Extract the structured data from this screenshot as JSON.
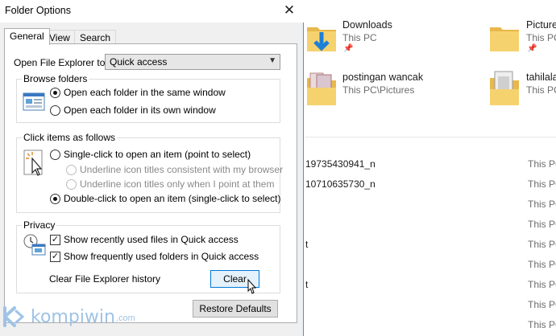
{
  "dialog": {
    "title": "Folder Options",
    "tabs": [
      {
        "label": "General",
        "active": true
      },
      {
        "label": "View",
        "active": false
      },
      {
        "label": "Search",
        "active": false
      }
    ],
    "open_explorer_label": "Open File Explorer to:",
    "open_explorer_value": "Quick access",
    "browse_folders": {
      "legend": "Browse folders",
      "options": [
        {
          "label": "Open each folder in the same window",
          "selected": true
        },
        {
          "label": "Open each folder in its own window",
          "selected": false
        }
      ]
    },
    "click_items": {
      "legend": "Click items as follows",
      "single_click": {
        "label": "Single-click to open an item (point to select)",
        "selected": false
      },
      "underline_consistent": {
        "label": "Underline icon titles consistent with my browser",
        "enabled": false
      },
      "underline_point": {
        "label": "Underline icon titles only when I point at them",
        "enabled": false
      },
      "double_click": {
        "label": "Double-click to open an item (single-click to select)",
        "selected": true
      }
    },
    "privacy": {
      "legend": "Privacy",
      "show_recent_files": {
        "label": "Show recently used files in Quick access",
        "checked": true
      },
      "show_frequent_folders": {
        "label": "Show frequently used folders in Quick access",
        "checked": true
      },
      "clear_history_label": "Clear File Explorer history",
      "clear_button": "Clear"
    },
    "restore_defaults_button": "Restore Defaults"
  },
  "explorer": {
    "quick_access": [
      {
        "name": "Downloads",
        "location": "This PC",
        "icon": "downloads-folder-icon"
      },
      {
        "name": "Picture",
        "location": "This PC",
        "icon": "pictures-folder-icon"
      },
      {
        "name": "postingan wancak",
        "location": "This PC\\Pictures",
        "icon": "image-folder-icon"
      },
      {
        "name": "tahilala",
        "location": "This PC",
        "icon": "image-folder-icon"
      }
    ],
    "recent_files": [
      {
        "name": "19735430941_n",
        "location": "This PC"
      },
      {
        "name": "10710635730_n",
        "location": "This PC"
      },
      {
        "name": "",
        "location": "This PC"
      },
      {
        "name": "",
        "location": "This PC"
      },
      {
        "name": "t",
        "location": "This PC"
      },
      {
        "name": "",
        "location": "This PC"
      },
      {
        "name": "t",
        "location": "This PC"
      },
      {
        "name": "",
        "location": "This PC"
      },
      {
        "name": "",
        "location": "This PC"
      }
    ]
  },
  "watermark": {
    "text": "kompiwin",
    "domain": ".com"
  },
  "colors": {
    "accent": "#0078d7",
    "folder": "#f0c65c",
    "download": "#1f7fd6"
  }
}
